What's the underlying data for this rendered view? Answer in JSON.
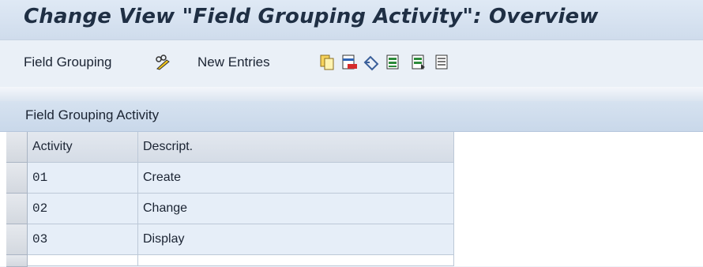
{
  "window": {
    "title": "Change View \"Field Grouping Activity\": Overview"
  },
  "toolbar": {
    "field_grouping_label": "Field Grouping",
    "new_entries_label": "New Entries",
    "icons": [
      "glasses-pencil-icon",
      "copy-icon",
      "delete-icon",
      "undo-icon",
      "select-all-icon",
      "select-block-icon",
      "deselect-all-icon"
    ]
  },
  "section": {
    "title": "Field Grouping Activity"
  },
  "table": {
    "columns": [
      "Activity",
      "Descript."
    ],
    "rows": [
      {
        "activity": "01",
        "description": "Create"
      },
      {
        "activity": "02",
        "description": "Change"
      },
      {
        "activity": "03",
        "description": "Display"
      }
    ]
  }
}
